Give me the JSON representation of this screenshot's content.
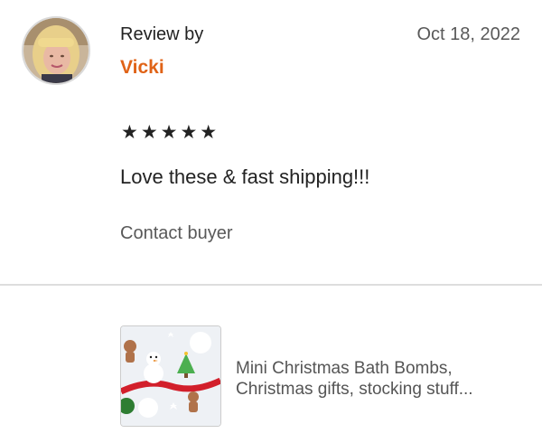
{
  "review": {
    "header_label": "Review by",
    "reviewer_name": "Vicki",
    "date": "Oct 18, 2022",
    "rating": 5,
    "stars_text": "★★★★★",
    "text": "Love these & fast shipping!!!",
    "contact_label": "Contact buyer"
  },
  "product": {
    "title_line1": "Mini Christmas Bath Bombs,",
    "title_line2": "Christmas gifts, stocking stuff..."
  },
  "colors": {
    "accent": "#e06317",
    "text_primary": "#222222",
    "text_secondary": "#595959",
    "divider": "#dddddd"
  }
}
